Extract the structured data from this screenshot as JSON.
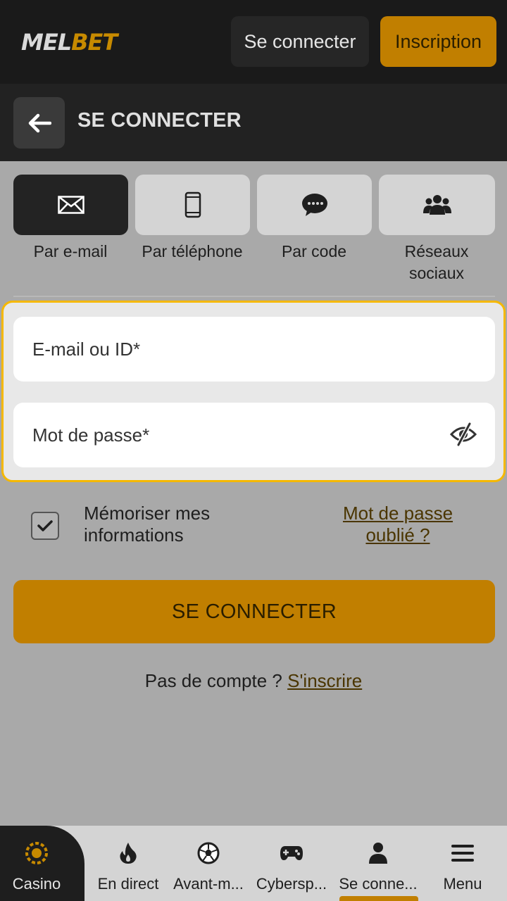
{
  "header": {
    "logo_left": "MEL",
    "logo_right": "BET",
    "login_label": "Se connecter",
    "register_label": "Inscription"
  },
  "page": {
    "title": "SE CONNECTER"
  },
  "tabs": [
    {
      "label": "Par e-mail",
      "icon": "envelope-icon",
      "active": true
    },
    {
      "label": "Par téléphone",
      "icon": "phone-icon",
      "active": false
    },
    {
      "label": "Par code",
      "icon": "chat-bubble-icon",
      "active": false
    },
    {
      "label": "Réseaux sociaux",
      "icon": "group-icon",
      "active": false
    }
  ],
  "form": {
    "email_placeholder": "E-mail ou ID*",
    "password_placeholder": "Mot de passe*",
    "remember_label": "Mémoriser mes informations",
    "remember_checked": true,
    "forgot_label": "Mot de passe oublié ?",
    "submit_label": "SE CONNECTER",
    "no_account_text": "Pas de compte ? ",
    "signup_link": "S'inscrire"
  },
  "bottom_nav": [
    {
      "label": "Casino",
      "icon": "casino-chip-icon"
    },
    {
      "label": "En direct",
      "icon": "flame-icon"
    },
    {
      "label": "Avant-m...",
      "icon": "soccer-ball-icon"
    },
    {
      "label": "Cybersp...",
      "icon": "gamepad-icon"
    },
    {
      "label": "Se conne...",
      "icon": "user-icon",
      "active": true
    },
    {
      "label": "Menu",
      "icon": "hamburger-menu-icon"
    }
  ],
  "colors": {
    "accent": "#c17f00",
    "highlight_border": "#f5b800",
    "dark": "#1a1a1a",
    "overlay_gray": "#a9a9a9"
  }
}
